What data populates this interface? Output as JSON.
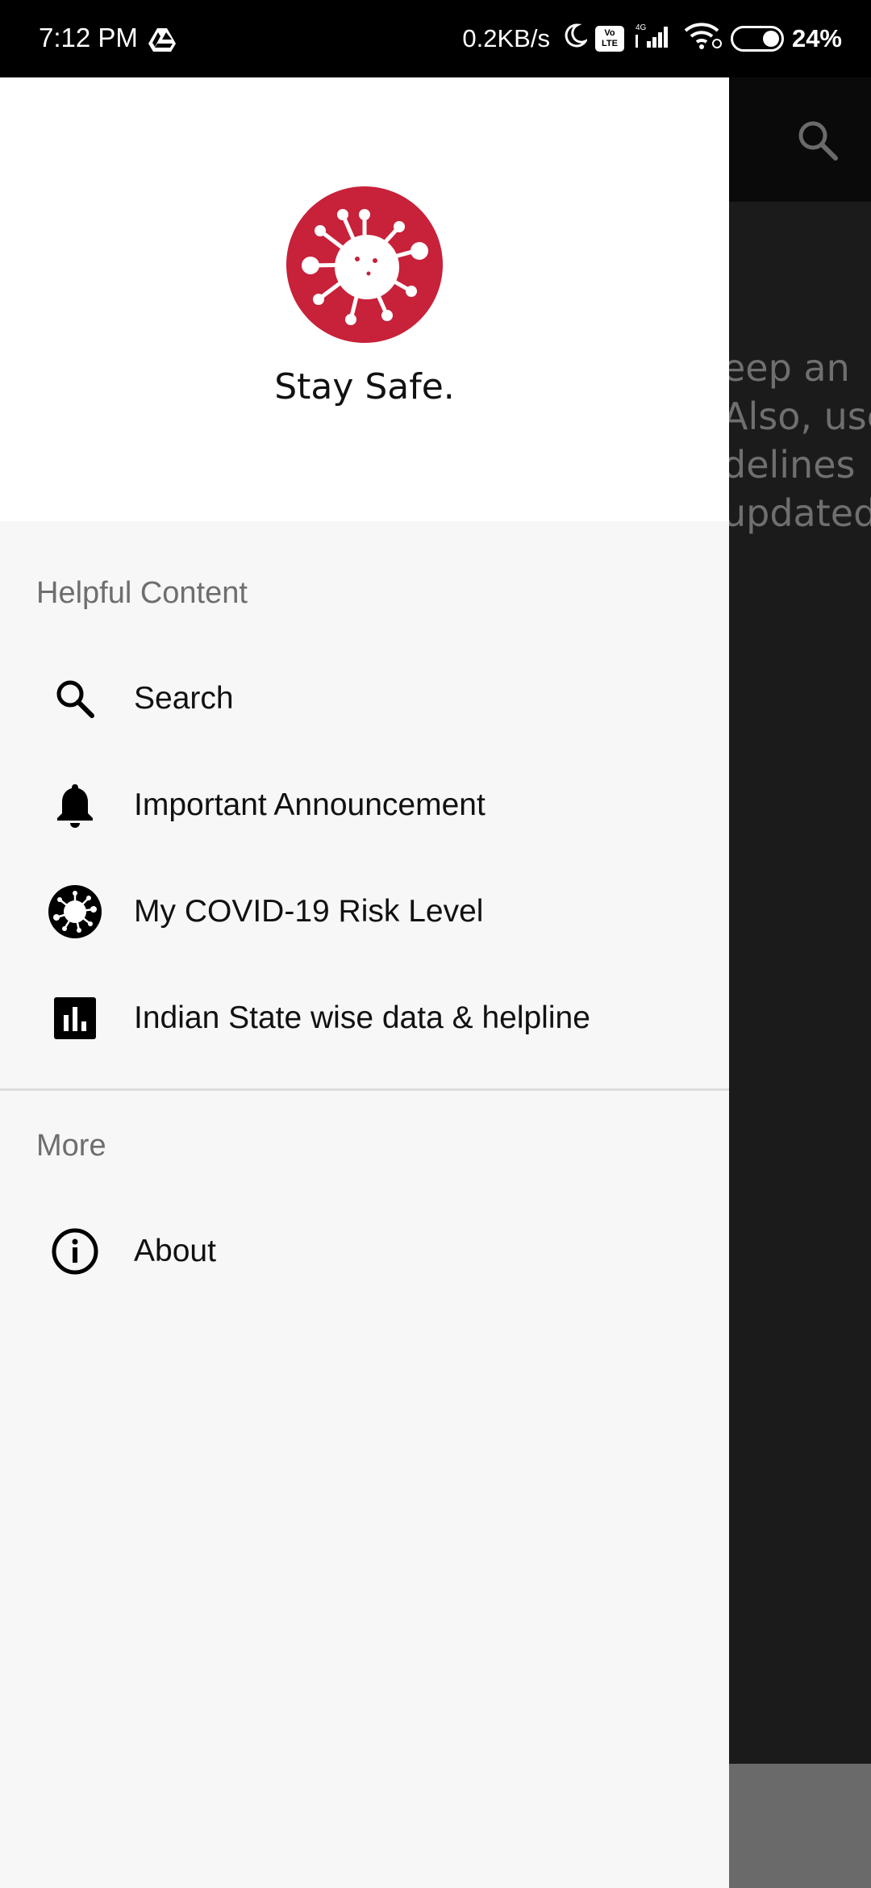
{
  "status_bar": {
    "time": "7:12 PM",
    "speed": "0.2KB/s",
    "volte": "Vo LTE",
    "network": "4G",
    "battery": "24%"
  },
  "background": {
    "text_lines": [
      "eep an",
      "Also, use",
      "delines",
      "updated"
    ]
  },
  "drawer": {
    "header": {
      "title": "Stay Safe."
    },
    "sections": [
      {
        "title": "Helpful Content",
        "items": [
          {
            "label": "Search",
            "icon": "search-icon"
          },
          {
            "label": "Important Announcement",
            "icon": "bell-icon"
          },
          {
            "label": "My COVID-19 Risk Level",
            "icon": "virus-icon"
          },
          {
            "label": "Indian State wise data & helpline",
            "icon": "bar-chart-icon"
          }
        ]
      },
      {
        "title": "More",
        "items": [
          {
            "label": "About",
            "icon": "info-icon"
          }
        ]
      }
    ]
  },
  "colors": {
    "brand_red": "#c8213a",
    "drawer_bg": "#f7f7f7",
    "scrim": "#1b1b1b"
  }
}
